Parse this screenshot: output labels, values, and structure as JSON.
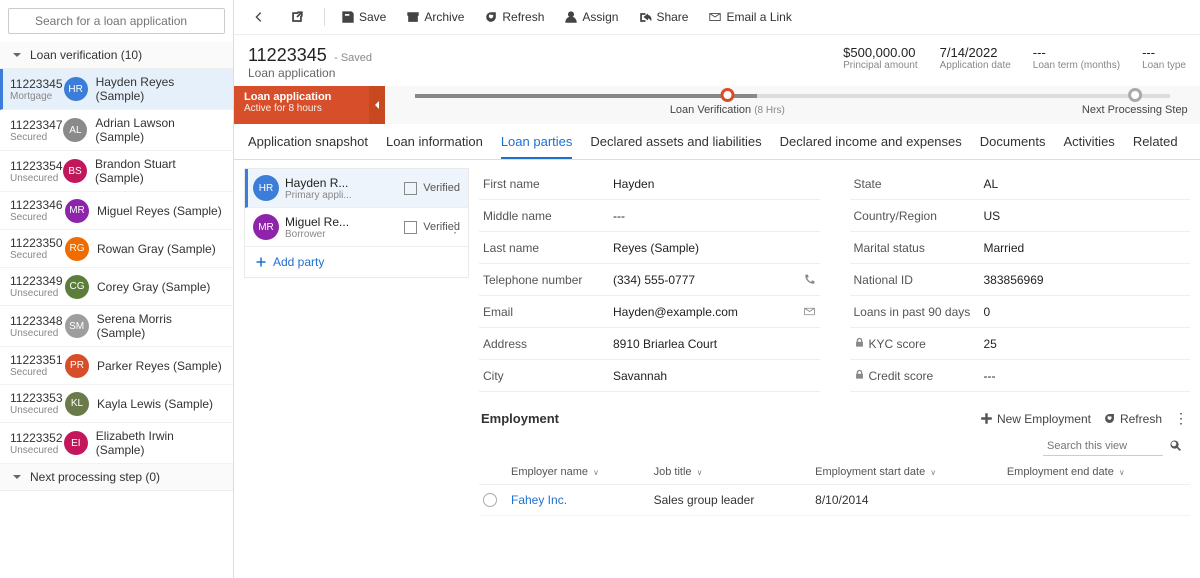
{
  "sidebar": {
    "search_placeholder": "Search for a loan application",
    "section1": {
      "label": "Loan verification (10)"
    },
    "section2": {
      "label": "Next processing step (0)"
    },
    "items": [
      {
        "id": "11223345",
        "sub": "Mortgage",
        "initials": "HR",
        "color": "#3b7dd8",
        "name": "Hayden Reyes (Sample)"
      },
      {
        "id": "11223347",
        "sub": "Secured",
        "initials": "AL",
        "color": "#8a8a8a",
        "name": "Adrian Lawson (Sample)"
      },
      {
        "id": "11223354",
        "sub": "Unsecured",
        "initials": "BS",
        "color": "#c2185b",
        "name": "Brandon Stuart (Sample)"
      },
      {
        "id": "11223346",
        "sub": "Secured",
        "initials": "MR",
        "color": "#8e24aa",
        "name": "Miguel Reyes (Sample)"
      },
      {
        "id": "11223350",
        "sub": "Secured",
        "initials": "RG",
        "color": "#ef6c00",
        "name": "Rowan Gray (Sample)"
      },
      {
        "id": "11223349",
        "sub": "Unsecured",
        "initials": "CG",
        "color": "#5d7e3a",
        "name": "Corey Gray (Sample)"
      },
      {
        "id": "11223348",
        "sub": "Unsecured",
        "initials": "SM",
        "color": "#9e9e9e",
        "name": "Serena Morris (Sample)"
      },
      {
        "id": "11223351",
        "sub": "Secured",
        "initials": "PR",
        "color": "#d64f2a",
        "name": "Parker Reyes (Sample)"
      },
      {
        "id": "11223353",
        "sub": "Unsecured",
        "initials": "KL",
        "color": "#6a7a4a",
        "name": "Kayla Lewis (Sample)"
      },
      {
        "id": "11223352",
        "sub": "Unsecured",
        "initials": "EI",
        "color": "#c2185b",
        "name": "Elizabeth Irwin (Sample)"
      }
    ]
  },
  "toolbar": {
    "back": "",
    "popout": "",
    "save": "Save",
    "archive": "Archive",
    "refresh": "Refresh",
    "assign": "Assign",
    "share": "Share",
    "email": "Email a Link"
  },
  "header": {
    "title": "11223345",
    "saved": "- Saved",
    "subtitle": "Loan application",
    "metrics": [
      {
        "v": "$500,000.00",
        "l": "Principal amount"
      },
      {
        "v": "7/14/2022",
        "l": "Application date"
      },
      {
        "v": "---",
        "l": "Loan term (months)"
      },
      {
        "v": "---",
        "l": "Loan type"
      }
    ]
  },
  "stage": {
    "chip_title": "Loan application",
    "chip_sub": "Active for 8 hours",
    "steps": [
      {
        "label": "Loan Verification",
        "sub": "(8 Hrs)"
      },
      {
        "label": "Next Processing Step",
        "sub": ""
      }
    ]
  },
  "tabs": [
    "Application snapshot",
    "Loan information",
    "Loan parties",
    "Declared assets and liabilities",
    "Declared income and expenses",
    "Documents",
    "Activities",
    "Related"
  ],
  "active_tab_index": 2,
  "parties": [
    {
      "initials": "HR",
      "color": "#3b7dd8",
      "name": "Hayden R...",
      "role": "Primary appli...",
      "verified_label": "Verified"
    },
    {
      "initials": "MR",
      "color": "#8e24aa",
      "name": "Miguel Re...",
      "role": "Borrower",
      "verified_label": "Verified"
    }
  ],
  "add_party_label": "Add party",
  "fields_left": [
    {
      "label": "First name",
      "value": "Hayden"
    },
    {
      "label": "Middle name",
      "value": "---"
    },
    {
      "label": "Last name",
      "value": "Reyes (Sample)"
    },
    {
      "label": "Telephone number",
      "value": "(334) 555-0777",
      "icon": "phone"
    },
    {
      "label": "Email",
      "value": "Hayden@example.com",
      "icon": "mail"
    },
    {
      "label": "Address",
      "value": "8910 Briarlea Court"
    },
    {
      "label": "City",
      "value": "Savannah"
    }
  ],
  "fields_right": [
    {
      "label": "State",
      "value": "AL"
    },
    {
      "label": "Country/Region",
      "value": "US"
    },
    {
      "label": "Marital status",
      "value": "Married"
    },
    {
      "label": "National ID",
      "value": "383856969"
    },
    {
      "label": "Loans in past 90 days",
      "value": "0"
    },
    {
      "label": "KYC score",
      "value": "25",
      "locked": true
    },
    {
      "label": "Credit score",
      "value": "---",
      "locked": true
    }
  ],
  "employment": {
    "heading": "Employment",
    "new_label": "New Employment",
    "refresh_label": "Refresh",
    "search_placeholder": "Search this view",
    "columns": [
      "Employer name",
      "Job title",
      "Employment start date",
      "Employment end date"
    ],
    "rows": [
      {
        "employer": "Fahey Inc.",
        "title": "Sales group leader",
        "start": "8/10/2014",
        "end": ""
      }
    ]
  }
}
